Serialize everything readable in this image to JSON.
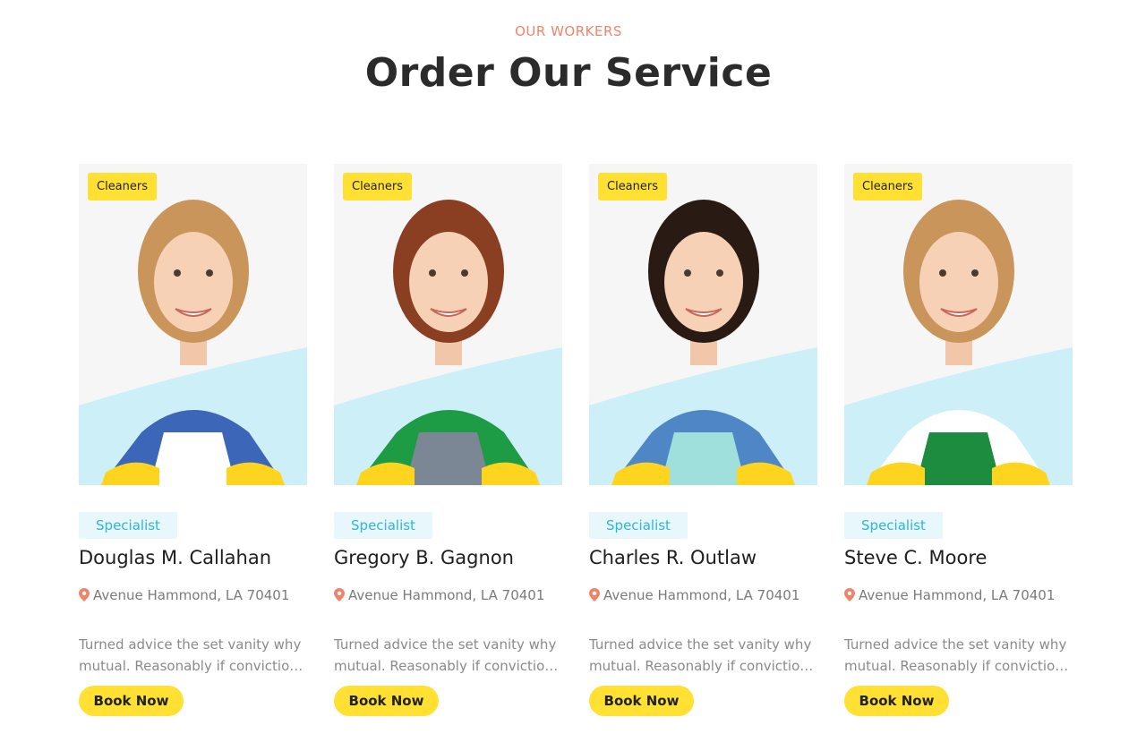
{
  "section": {
    "eyebrow": "OUR WORKERS",
    "title": "Order Our Service"
  },
  "colors": {
    "accent_yellow": "#ffe033",
    "eyebrow_coral": "#f0846a",
    "role_blue": "#2fb6d6",
    "role_bg": "#e7f7fc",
    "wave_blue": "#cdeff8",
    "pin_coral": "#f0846a"
  },
  "workers": [
    {
      "category": "Cleaners",
      "role": "Specialist",
      "name": "Douglas M. Callahan",
      "address": "Avenue Hammond, LA 70401",
      "description_line1": "Turned advice the set vanity why",
      "description_line2": "mutual. Reasonably if conviction...",
      "button": "Book Now",
      "hair": "#c9955a",
      "shirt": "#3c66b8",
      "apron": "#ffffff"
    },
    {
      "category": "Cleaners",
      "role": "Specialist",
      "name": "Gregory B. Gagnon",
      "address": "Avenue Hammond, LA 70401",
      "description_line1": "Turned advice the set vanity why",
      "description_line2": "mutual. Reasonably if conviction...",
      "button": "Book Now",
      "hair": "#8a3f22",
      "shirt": "#1e9b45",
      "apron": "#7b8794"
    },
    {
      "category": "Cleaners",
      "role": "Specialist",
      "name": "Charles R. Outlaw",
      "address": "Avenue Hammond, LA 70401",
      "description_line1": "Turned advice the set vanity why",
      "description_line2": "mutual. Reasonably if conviction...",
      "button": "Book Now",
      "hair": "#2a1a14",
      "shirt": "#4f86c6",
      "apron": "#9fe0dc"
    },
    {
      "category": "Cleaners",
      "role": "Specialist",
      "name": "Steve C. Moore",
      "address": "Avenue Hammond, LA 70401",
      "description_line1": "Turned advice the set vanity why",
      "description_line2": "mutual. Reasonably if conviction...",
      "button": "Book Now",
      "hair": "#c9955a",
      "shirt": "#ffffff",
      "apron": "#1d8c3f"
    }
  ]
}
